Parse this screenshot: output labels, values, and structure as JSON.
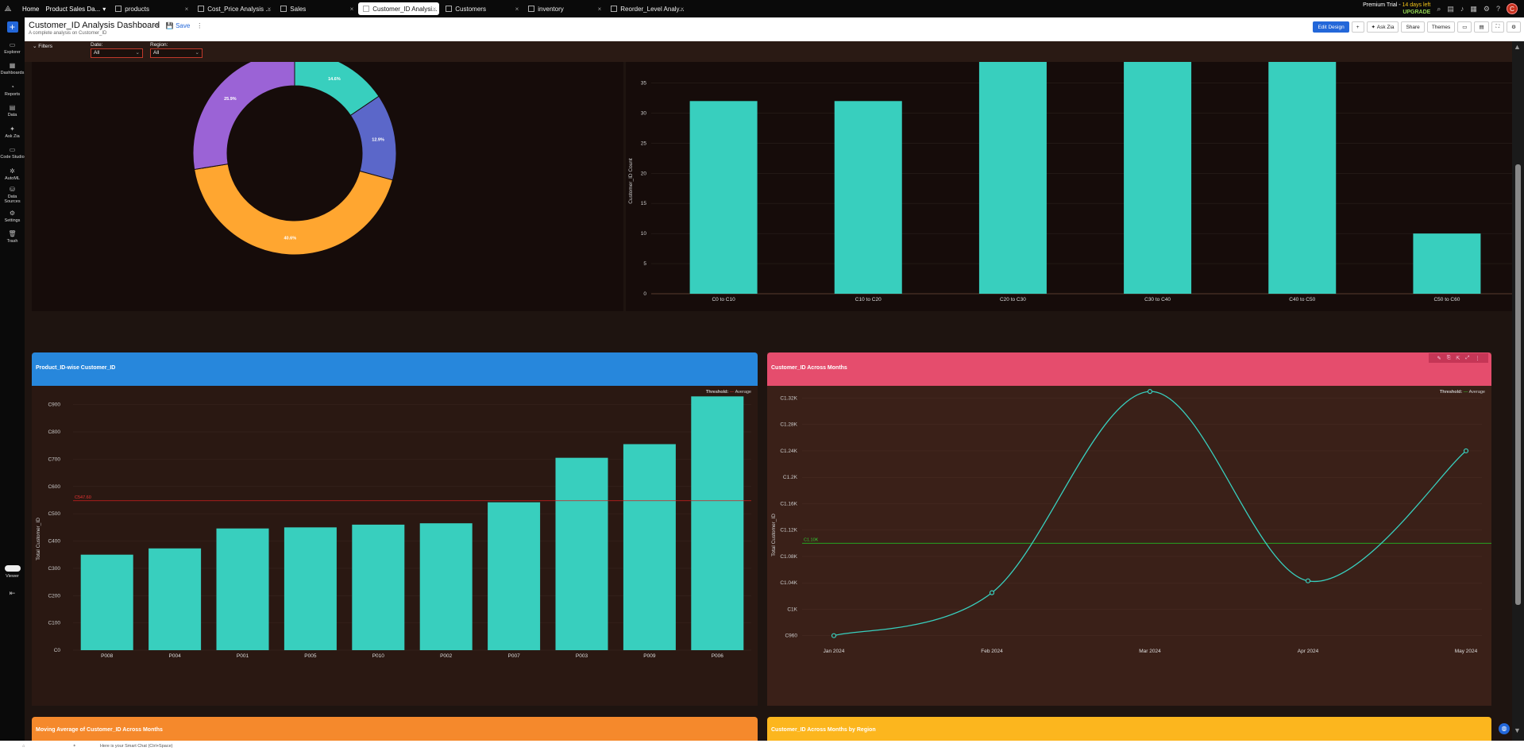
{
  "topbar": {
    "home": "Home",
    "workspace": "Product Sales Da...",
    "tabs": [
      {
        "label": "products"
      },
      {
        "label": "Cost_Price Analysis ..."
      },
      {
        "label": "Sales"
      },
      {
        "label": "Customer_ID Analysi..."
      },
      {
        "label": "Customers"
      },
      {
        "label": "inventory"
      },
      {
        "label": "Reorder_Level Analy..."
      }
    ],
    "trial_label": "Premium Trial -",
    "trial_days": "14 days left",
    "upgrade": "UPGRADE",
    "avatar": "C"
  },
  "sidebar": {
    "items": [
      {
        "icon": "folder-icon",
        "label": "Explorer"
      },
      {
        "icon": "dashboard-icon",
        "label": "Dashboards"
      },
      {
        "icon": "reports-icon",
        "label": "Reports"
      },
      {
        "icon": "data-icon",
        "label": "Data"
      },
      {
        "icon": "ask-zia-icon",
        "label": "Ask Zia"
      },
      {
        "icon": "code-icon",
        "label": "Code Studio"
      },
      {
        "icon": "automl-icon",
        "label": "AutoML"
      },
      {
        "icon": "data-sources-icon",
        "label": "Data Sources"
      },
      {
        "icon": "settings-icon",
        "label": "Settings"
      },
      {
        "icon": "trash-icon",
        "label": "Trash"
      }
    ],
    "viewer": "Viewer"
  },
  "header": {
    "title": "Customer_ID Analysis Dashboard",
    "subtitle": "A complete analysis on Customer_ID",
    "save": "Save",
    "buttons": [
      "Edit Design",
      "+",
      "Ask Zia",
      "Share",
      "Themes"
    ]
  },
  "filters": {
    "label": "Filters",
    "date_label": "Date:",
    "date_value": "All",
    "region_label": "Region:",
    "region_value": "All"
  },
  "panels": {
    "p3_title": "Product_ID-wise Customer_ID",
    "p4_title": "Customer_ID Across Months",
    "p5_title": "Moving Average of Customer_ID Across Months",
    "p6_title": "Customer_ID Across Months by Region",
    "threshold_label": "Threshold:",
    "average_label": "Average"
  },
  "chart_data": [
    {
      "type": "pie",
      "donut": true,
      "values": [
        14.6,
        12.9,
        40.6,
        25.9
      ],
      "labels": [
        "14.6%",
        "12.9%",
        "40.6%",
        "25.9%"
      ],
      "colors": [
        "#38cfbe",
        "#5b67c9",
        "#ffa630",
        "#9b63d6"
      ]
    },
    {
      "type": "bar",
      "categories": [
        "C0 to C10",
        "C10 to C20",
        "C20 to C30",
        "C30 to C40",
        "C40 to C50",
        "C50 to C60"
      ],
      "values": [
        32,
        32,
        38.5,
        38.5,
        38.5,
        10
      ],
      "ylabel": "Customer_ID Count",
      "yticks": [
        0,
        5,
        10,
        15,
        20,
        25,
        30,
        35
      ],
      "ylim": [
        0,
        38.5
      ],
      "color": "#38cfbe"
    },
    {
      "type": "bar",
      "categories": [
        "P008",
        "P004",
        "P001",
        "P005",
        "P010",
        "P002",
        "P007",
        "P003",
        "P009",
        "P006"
      ],
      "values": [
        350,
        373,
        446,
        450,
        460,
        465,
        542,
        705,
        755,
        930
      ],
      "ylabel": "Total Customer_ID",
      "ytick_labels": [
        "C0",
        "C100",
        "C200",
        "C300",
        "C400",
        "C500",
        "C600",
        "C700",
        "C800",
        "C900"
      ],
      "yticks": [
        0,
        100,
        200,
        300,
        400,
        500,
        600,
        700,
        800,
        900
      ],
      "ylim": [
        0,
        960
      ],
      "average": 547.6,
      "average_label": "C547.60",
      "color": "#38cfbe"
    },
    {
      "type": "line",
      "categories": [
        "Jan 2024",
        "Feb 2024",
        "Mar 2024",
        "Apr 2024",
        "May 2024"
      ],
      "values": [
        960,
        1025,
        1330,
        1043,
        1240
      ],
      "ylabel": "Total Customer_ID",
      "ytick_labels": [
        "C960",
        "C1K",
        "C1.04K",
        "C1.08K",
        "C1.12K",
        "C1.16K",
        "C1.2K",
        "C1.24K",
        "C1.28K",
        "C1.32K"
      ],
      "yticks": [
        960,
        1000,
        1040,
        1080,
        1120,
        1160,
        1200,
        1240,
        1280,
        1320
      ],
      "ylim": [
        950,
        1335
      ],
      "average": 1100,
      "average_label": "C1.10K",
      "color": "#38cfbe"
    }
  ],
  "bottom": {
    "smart_chat": "Here is your Smart Chat (Ctrl+Space)"
  }
}
